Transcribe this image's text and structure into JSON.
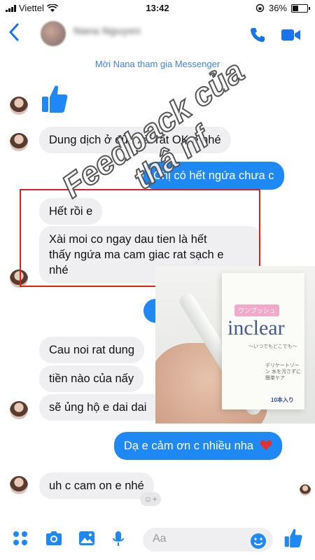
{
  "status": {
    "carrier": "Viettel",
    "time": "13:42",
    "battery": "36%"
  },
  "header": {
    "contact_name": "Nana Nguyen"
  },
  "banner": "Mời Nana tham gia Messenger",
  "watermark": {
    "line1": "Feedback của",
    "line2": "thâ nf"
  },
  "messages": {
    "m1": "Dung dịch ở đũa xài rất OK e nhé",
    "m2": "Chị có hết ngứa chưa c",
    "m3": "Hết rồi e",
    "m4_line1": "Xài moi co ngay dau tien là hết",
    "m4_line2": "thấy ngứa ma cam giac rat sạch e",
    "m4_line3": "nhé",
    "m5": "Cau noi rat dung",
    "m6": "tiền nào của nấy",
    "m7": "sẽ ủng hộ e dai dai",
    "m8": "Dạ e cảm ơn c nhiều nha",
    "m9": "uh c cam on e nhé"
  },
  "product": {
    "brand": "inclear",
    "small": "ワンプッシュ",
    "sub": "〜いつでもどこでも〜",
    "jp": "デリケートゾーン 水を汚さずに 簡単ケア",
    "count": "10本入り"
  },
  "composer": {
    "placeholder": "Aa",
    "react_icon": "☺+"
  },
  "colors": {
    "messenger_blue": "#1e88f5",
    "incoming_bg": "#efeff2",
    "highlight": "#e0201c"
  }
}
